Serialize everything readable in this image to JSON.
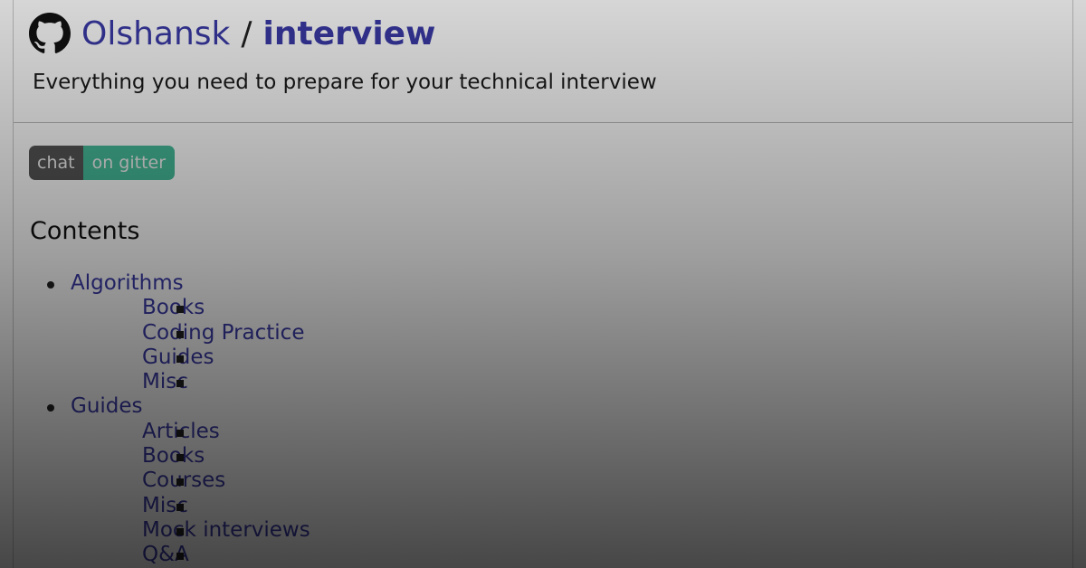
{
  "header": {
    "icon": "github-icon",
    "owner": "Olshansk",
    "separator": "/",
    "repo": "interview",
    "description": "Everything you need to prepare for your technical interview"
  },
  "badge": {
    "left": "chat",
    "right": "on gitter",
    "right_color": "#46bc99",
    "left_color": "#555555"
  },
  "contents": {
    "heading": "Contents",
    "items": [
      {
        "label": "Algorithms",
        "children": [
          "Books",
          "Coding Practice",
          "Guides",
          "Misc"
        ]
      },
      {
        "label": "Guides",
        "children": [
          "Articles",
          "Books",
          "Courses",
          "Misc",
          "Mock interviews",
          "Q&A"
        ]
      }
    ]
  },
  "colors": {
    "link": "#3a3aa8",
    "text": "#1a1a1a"
  }
}
